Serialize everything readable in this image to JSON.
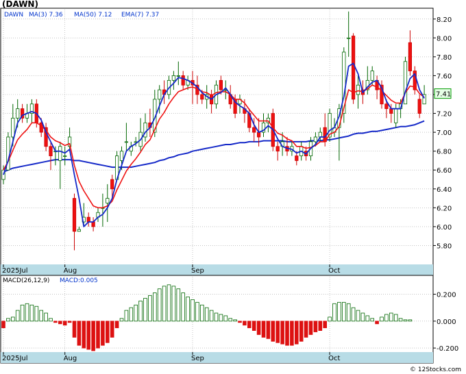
{
  "chart_data": [
    {
      "type": "candlestick",
      "title": "(DAWN)",
      "legend_items": [
        {
          "id": "sym",
          "text": "DAWN"
        },
        {
          "id": "ma3",
          "text": "MA(3)  7.36"
        },
        {
          "id": "ma50",
          "text": "MA(50)  7.12"
        },
        {
          "id": "ema7",
          "text": "EMA(7)  7.37"
        }
      ],
      "last_price_label": "7.41",
      "ylim": [
        5.6,
        8.3
      ],
      "ytick_labels": [
        "5.80",
        "6.00",
        "6.20",
        "6.40",
        "6.60",
        "6.80",
        "7.00",
        "7.20",
        "7.40",
        "7.60",
        "7.80",
        "8.00",
        "8.20"
      ],
      "xtick_labels": [
        {
          "label": "2025Jul",
          "index": 0
        },
        {
          "label": "Aug",
          "index": 13
        },
        {
          "label": "Sep",
          "index": 40
        },
        {
          "label": "Oct",
          "index": 69
        }
      ],
      "candles": [
        [
          6.5,
          6.65,
          6.45,
          6.6
        ],
        [
          6.6,
          7.0,
          6.6,
          6.95
        ],
        [
          6.95,
          7.3,
          6.85,
          7.15
        ],
        [
          7.15,
          7.35,
          7.05,
          7.25
        ],
        [
          7.25,
          7.3,
          7.1,
          7.15
        ],
        [
          7.15,
          7.3,
          7.1,
          7.2
        ],
        [
          7.2,
          7.35,
          7.1,
          7.3
        ],
        [
          7.3,
          7.35,
          7.05,
          7.1
        ],
        [
          7.1,
          7.15,
          6.95,
          7.0
        ],
        [
          7.05,
          7.1,
          6.8,
          6.85
        ],
        [
          6.85,
          6.9,
          6.6,
          6.75
        ],
        [
          6.8,
          6.85,
          6.65,
          6.8
        ],
        [
          6.7,
          6.9,
          6.4,
          6.85
        ],
        [
          6.75,
          6.85,
          6.65,
          6.75
        ],
        [
          6.85,
          7.05,
          6.8,
          6.95
        ],
        [
          6.3,
          6.35,
          5.75,
          5.95
        ],
        [
          5.95,
          6.0,
          5.95,
          5.97
        ],
        [
          6.05,
          6.25,
          6.0,
          6.1
        ],
        [
          6.1,
          6.15,
          6.0,
          6.05
        ],
        [
          6.05,
          6.1,
          5.95,
          6.0
        ],
        [
          6.1,
          6.2,
          6.05,
          6.15
        ],
        [
          6.2,
          6.35,
          6.0,
          6.2
        ],
        [
          6.25,
          6.45,
          6.05,
          6.3
        ],
        [
          6.5,
          6.55,
          6.3,
          6.4
        ],
        [
          6.5,
          6.8,
          6.5,
          6.75
        ],
        [
          6.7,
          6.85,
          6.6,
          6.8
        ],
        [
          6.9,
          7.1,
          6.8,
          6.9
        ],
        [
          6.8,
          6.9,
          6.75,
          6.85
        ],
        [
          6.9,
          6.95,
          6.85,
          6.9
        ],
        [
          6.85,
          7.15,
          6.8,
          7.0
        ],
        [
          6.95,
          7.2,
          6.9,
          7.1
        ],
        [
          7.1,
          7.25,
          6.95,
          7.05
        ],
        [
          7.0,
          7.45,
          6.95,
          7.35
        ],
        [
          7.35,
          7.5,
          7.2,
          7.45
        ],
        [
          7.45,
          7.55,
          7.3,
          7.4
        ],
        [
          7.4,
          7.6,
          7.35,
          7.55
        ],
        [
          7.55,
          7.65,
          7.45,
          7.6
        ],
        [
          7.6,
          7.75,
          7.5,
          7.6
        ],
        [
          7.6,
          7.65,
          7.45,
          7.5
        ],
        [
          7.5,
          7.6,
          7.45,
          7.55
        ],
        [
          7.55,
          7.65,
          7.3,
          7.5
        ],
        [
          7.5,
          7.6,
          7.3,
          7.4
        ],
        [
          7.4,
          7.45,
          7.3,
          7.35
        ],
        [
          7.35,
          7.5,
          7.25,
          7.4
        ],
        [
          7.4,
          7.45,
          7.2,
          7.3
        ],
        [
          7.3,
          7.55,
          7.25,
          7.5
        ],
        [
          7.55,
          7.6,
          7.4,
          7.45
        ],
        [
          7.45,
          7.55,
          7.35,
          7.45
        ],
        [
          7.4,
          7.5,
          7.25,
          7.3
        ],
        [
          7.35,
          7.4,
          7.15,
          7.2
        ],
        [
          7.3,
          7.4,
          7.2,
          7.35
        ],
        [
          7.25,
          7.35,
          7.1,
          7.2
        ],
        [
          7.2,
          7.25,
          7.0,
          7.05
        ],
        [
          7.05,
          7.15,
          6.9,
          7.0
        ],
        [
          7.0,
          7.15,
          6.85,
          6.95
        ],
        [
          7.0,
          7.2,
          6.95,
          7.1
        ],
        [
          7.1,
          7.2,
          7.0,
          7.15
        ],
        [
          7.2,
          7.25,
          6.8,
          6.85
        ],
        [
          6.85,
          6.9,
          6.7,
          6.8
        ],
        [
          6.85,
          7.0,
          6.75,
          6.9
        ],
        [
          6.85,
          6.95,
          6.75,
          6.8
        ],
        [
          6.8,
          6.9,
          6.75,
          6.85
        ],
        [
          6.75,
          6.8,
          6.65,
          6.7
        ],
        [
          6.75,
          6.9,
          6.7,
          6.85
        ],
        [
          6.8,
          6.85,
          6.7,
          6.75
        ],
        [
          6.75,
          6.95,
          6.7,
          6.9
        ],
        [
          6.9,
          7.0,
          6.85,
          6.95
        ],
        [
          6.95,
          7.05,
          6.9,
          7.0
        ],
        [
          7.05,
          7.2,
          6.85,
          6.9
        ],
        [
          6.95,
          7.25,
          6.9,
          7.2
        ],
        [
          7.0,
          7.15,
          6.95,
          7.05
        ],
        [
          7.05,
          7.3,
          6.7,
          7.25
        ],
        [
          7.2,
          7.9,
          7.1,
          7.85
        ],
        [
          8.0,
          8.28,
          7.8,
          8.0
        ],
        [
          8.02,
          8.05,
          7.3,
          7.35
        ],
        [
          7.4,
          7.6,
          7.25,
          7.5
        ],
        [
          7.45,
          7.55,
          7.3,
          7.4
        ],
        [
          7.45,
          7.7,
          7.4,
          7.55
        ],
        [
          7.55,
          7.7,
          7.5,
          7.65
        ],
        [
          7.55,
          7.6,
          7.35,
          7.45
        ],
        [
          7.5,
          7.55,
          7.25,
          7.3
        ],
        [
          7.3,
          7.35,
          7.15,
          7.25
        ],
        [
          7.25,
          7.3,
          7.1,
          7.2
        ],
        [
          7.1,
          7.3,
          7.05,
          7.25
        ],
        [
          7.25,
          7.35,
          7.15,
          7.3
        ],
        [
          7.3,
          7.8,
          7.3,
          7.75
        ],
        [
          7.95,
          8.08,
          7.6,
          7.65
        ],
        [
          7.65,
          7.7,
          7.4,
          7.45
        ],
        [
          7.35,
          7.4,
          7.15,
          7.2
        ],
        [
          7.3,
          7.5,
          7.3,
          7.4
        ]
      ],
      "ma3": [
        6.55,
        6.7,
        6.9,
        7.1,
        7.18,
        7.2,
        7.22,
        7.2,
        7.13,
        7.0,
        6.9,
        6.8,
        6.8,
        6.78,
        6.82,
        6.55,
        6.3,
        6.0,
        6.05,
        6.05,
        6.1,
        6.13,
        6.2,
        6.3,
        6.5,
        6.65,
        6.8,
        6.85,
        6.88,
        6.92,
        7.0,
        7.05,
        7.15,
        7.28,
        7.4,
        7.47,
        7.52,
        7.58,
        7.57,
        7.55,
        7.52,
        7.48,
        7.42,
        7.38,
        7.35,
        7.4,
        7.42,
        7.47,
        7.4,
        7.32,
        7.28,
        7.25,
        7.2,
        7.08,
        7.0,
        7.02,
        7.07,
        7.03,
        6.93,
        6.85,
        6.83,
        6.82,
        6.78,
        6.8,
        6.77,
        6.83,
        6.87,
        6.95,
        6.95,
        7.02,
        7.05,
        7.17,
        7.38,
        7.7,
        7.73,
        7.62,
        7.42,
        7.48,
        7.53,
        7.55,
        7.47,
        7.33,
        7.25,
        7.25,
        7.25,
        7.43,
        7.57,
        7.62,
        7.45,
        7.36
      ],
      "ma50": [
        6.58,
        6.6,
        6.62,
        6.63,
        6.64,
        6.65,
        6.66,
        6.67,
        6.68,
        6.69,
        6.7,
        6.71,
        6.71,
        6.71,
        6.71,
        6.7,
        6.7,
        6.69,
        6.68,
        6.67,
        6.66,
        6.65,
        6.64,
        6.63,
        6.63,
        6.63,
        6.63,
        6.63,
        6.64,
        6.65,
        6.66,
        6.67,
        6.68,
        6.7,
        6.71,
        6.73,
        6.74,
        6.76,
        6.77,
        6.78,
        6.8,
        6.81,
        6.82,
        6.83,
        6.84,
        6.85,
        6.86,
        6.87,
        6.87,
        6.88,
        6.89,
        6.89,
        6.9,
        6.9,
        6.9,
        6.91,
        6.91,
        6.91,
        6.91,
        6.91,
        6.9,
        6.9,
        6.9,
        6.9,
        6.9,
        6.91,
        6.91,
        6.91,
        6.92,
        6.92,
        6.93,
        6.94,
        6.95,
        6.96,
        6.98,
        6.99,
        6.99,
        7.0,
        7.01,
        7.01,
        7.02,
        7.03,
        7.04,
        7.05,
        7.06,
        7.06,
        7.07,
        7.08,
        7.1,
        7.12
      ],
      "ema7": [
        6.6,
        6.69,
        6.81,
        6.92,
        6.98,
        7.03,
        7.1,
        7.1,
        7.07,
        7.02,
        6.95,
        6.91,
        6.89,
        6.86,
        6.88,
        6.65,
        6.48,
        6.38,
        6.3,
        6.22,
        6.2,
        6.2,
        6.22,
        6.27,
        6.39,
        6.49,
        6.59,
        6.66,
        6.72,
        6.79,
        6.87,
        6.92,
        7.03,
        7.14,
        7.21,
        7.3,
        7.37,
        7.43,
        7.45,
        7.47,
        7.48,
        7.46,
        7.43,
        7.42,
        7.39,
        7.42,
        7.43,
        7.43,
        7.4,
        7.35,
        7.35,
        7.31,
        7.24,
        7.18,
        7.12,
        7.12,
        7.12,
        7.05,
        6.99,
        6.97,
        6.93,
        6.91,
        6.85,
        6.85,
        6.83,
        6.84,
        6.86,
        6.9,
        6.9,
        6.98,
        7.0,
        7.06,
        7.26,
        7.45,
        7.42,
        7.44,
        7.43,
        7.46,
        7.5,
        7.48,
        7.44,
        7.39,
        7.34,
        7.31,
        7.31,
        7.42,
        7.49,
        7.48,
        7.41,
        7.37
      ]
    },
    {
      "type": "bar",
      "title": "MACD(26,12,9)",
      "legend_items": [
        {
          "id": "macd",
          "text": "MACD:0.005"
        }
      ],
      "ylim": [
        -0.23,
        0.33
      ],
      "ytick_labels": [
        "-0.200",
        "0.000",
        "0.200"
      ],
      "xtick_labels": [
        {
          "label": "2025Jul",
          "index": 0
        },
        {
          "label": "Aug",
          "index": 13
        },
        {
          "label": "Sep",
          "index": 40
        },
        {
          "label": "Oct",
          "index": 69
        }
      ],
      "values": [
        -0.05,
        0.02,
        0.03,
        0.08,
        0.12,
        0.13,
        0.12,
        0.11,
        0.08,
        0.06,
        0.02,
        -0.01,
        -0.02,
        -0.03,
        -0.01,
        -0.12,
        -0.18,
        -0.2,
        -0.21,
        -0.22,
        -0.2,
        -0.18,
        -0.16,
        -0.12,
        -0.05,
        0.02,
        0.08,
        0.1,
        0.12,
        0.15,
        0.17,
        0.19,
        0.21,
        0.24,
        0.26,
        0.27,
        0.26,
        0.24,
        0.21,
        0.18,
        0.16,
        0.14,
        0.12,
        0.1,
        0.08,
        0.06,
        0.05,
        0.04,
        0.02,
        0.01,
        -0.01,
        -0.03,
        -0.05,
        -0.07,
        -0.1,
        -0.12,
        -0.13,
        -0.15,
        -0.16,
        -0.17,
        -0.18,
        -0.18,
        -0.17,
        -0.15,
        -0.12,
        -0.1,
        -0.08,
        -0.07,
        -0.05,
        0.03,
        0.13,
        0.14,
        0.14,
        0.13,
        0.1,
        0.08,
        0.06,
        0.04,
        0.02,
        -0.02,
        0.03,
        0.05,
        0.06,
        0.05,
        0.02,
        0.01,
        0.01
      ]
    }
  ],
  "footer": {
    "credit": "© 12Stocks.com"
  },
  "colors": {
    "bull_fill": "#ffffff",
    "bull_stroke": "#006600",
    "bear_fill": "#ee1111",
    "bear_stroke": "#cc0000",
    "ma_blue": "#1428c8",
    "ema_red": "#ee1111",
    "macd_pos": "#006600",
    "macd_neg": "#dd1111",
    "axis_band": "#b8dce6",
    "grid": "#a0a0a0",
    "price_tag_bg": "#e6ffe6"
  }
}
